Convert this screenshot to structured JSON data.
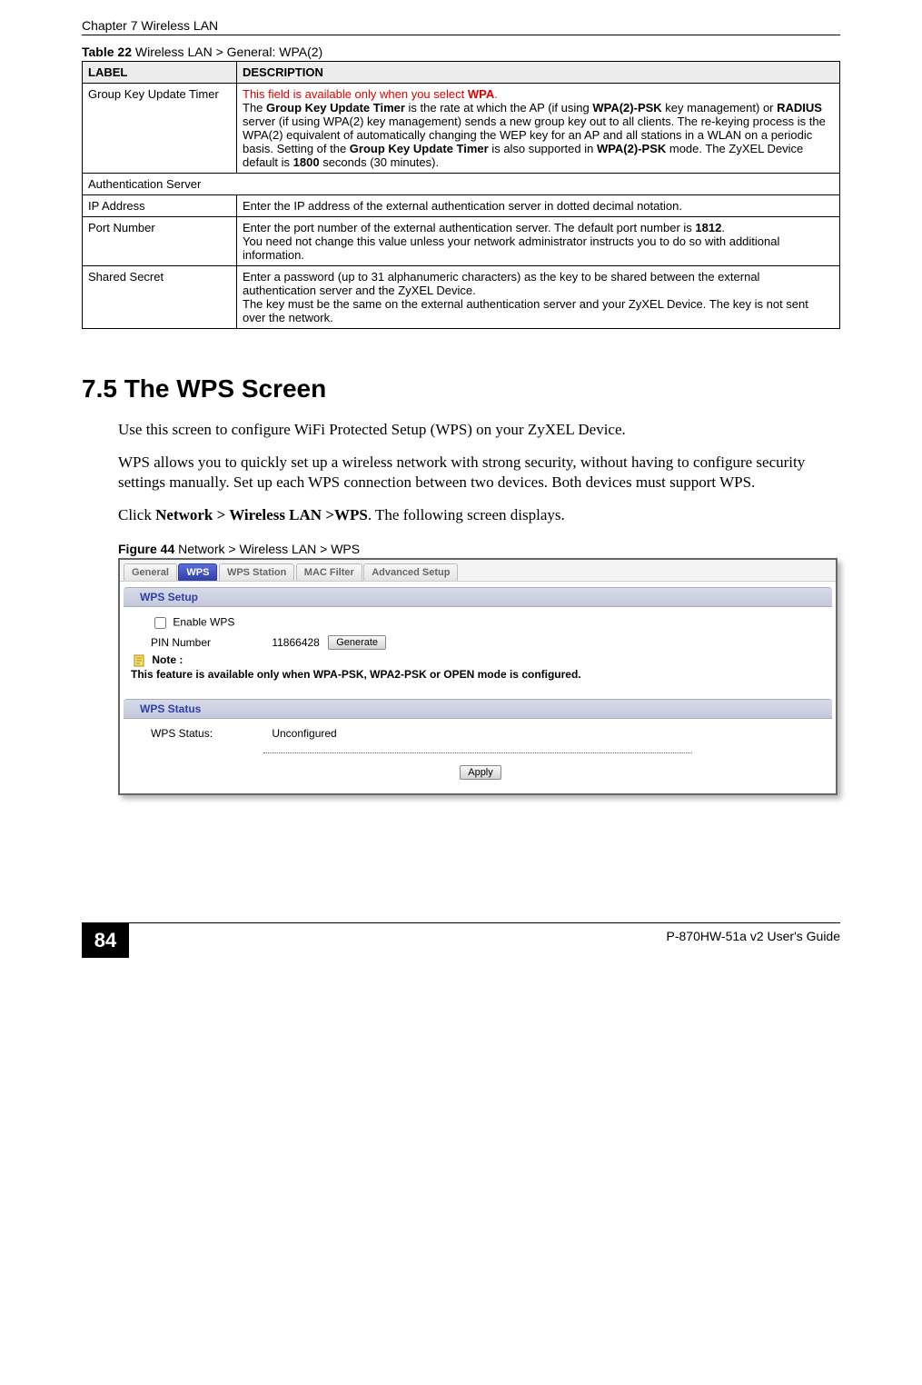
{
  "header": {
    "chapter_title": "Chapter 7 Wireless LAN"
  },
  "table": {
    "caption_prefix": "Table 22",
    "caption_rest": "   Wireless LAN > General: WPA(2)",
    "header_label": "LABEL",
    "header_desc": "DESCRIPTION",
    "rows": {
      "group_key": {
        "label": "Group Key Update Timer",
        "red_line": "This field is available only when you select ",
        "red_bold_end": "WPA",
        "red_period": ".",
        "p2_a": "The ",
        "p2_b": "Group Key Update Timer",
        "p2_c": " is the rate at which the AP (if using ",
        "p2_d": "WPA(2)-PSK",
        "p2_e": " key management) or ",
        "p2_f": "RADIUS",
        "p2_g": " server (if using WPA(2) key management) sends a new group key out to all clients. The re-keying process is the WPA(2) equivalent of automatically changing the WEP key for an AP and all stations in a WLAN on a periodic basis. Setting of the ",
        "p2_h": "Group Key Update Timer",
        "p2_i": " is also supported in ",
        "p2_j": "WPA(2)-PSK",
        "p2_k": " mode. The ZyXEL Device default is ",
        "p2_l": "1800",
        "p2_m": " seconds (30 minutes)."
      },
      "auth_server": {
        "label": "Authentication Server"
      },
      "ip_addr": {
        "label": "IP Address",
        "desc": "Enter the IP address of the external authentication server in dotted decimal notation."
      },
      "port_num": {
        "label": "Port Number",
        "d1_a": "Enter the port number of the external authentication server. The default port number is ",
        "d1_b": "1812",
        "d1_c": ".",
        "d2": "You need not change this value unless your network administrator instructs you to do so with additional information."
      },
      "shared_secret": {
        "label": "Shared Secret",
        "d1": "Enter a password (up to 31 alphanumeric characters) as the key to be shared between the external authentication server and the ZyXEL Device.",
        "d2": "The key must be the same on the external authentication server and your ZyXEL Device. The key is not sent over the network."
      }
    }
  },
  "section": {
    "heading": "7.5  The WPS Screen",
    "para1": "Use this screen to configure WiFi Protected Setup (WPS) on your ZyXEL Device.",
    "para2": "WPS allows you to quickly set up a wireless network with strong security, without having to configure security settings manually. Set up each WPS connection between two devices. Both devices must support WPS.",
    "para3_a": "Click ",
    "para3_b": "Network > Wireless LAN >",
    "para3_c": "WPS",
    "para3_d": ". The following screen displays."
  },
  "figure": {
    "caption_prefix": "Figure 44",
    "caption_rest": "   Network > Wireless LAN > WPS"
  },
  "screenshot": {
    "tabs": {
      "general": "General",
      "wps": "WPS",
      "wps_station": "WPS Station",
      "mac_filter": "MAC Filter",
      "advanced": "Advanced Setup"
    },
    "panel1_title": "WPS Setup",
    "enable_wps_label": "Enable WPS",
    "pin_number_label": "PIN Number",
    "pin_number_value": "11866428",
    "generate_btn": "Generate",
    "note_label": "Note :",
    "note_text": "This feature is available only when WPA-PSK, WPA2-PSK or OPEN mode is configured.",
    "panel2_title": "WPS Status",
    "wps_status_label": "WPS Status:",
    "wps_status_value": "Unconfigured",
    "apply_btn": "Apply"
  },
  "footer": {
    "page_number": "84",
    "guide": "P-870HW-51a v2 User's Guide"
  }
}
